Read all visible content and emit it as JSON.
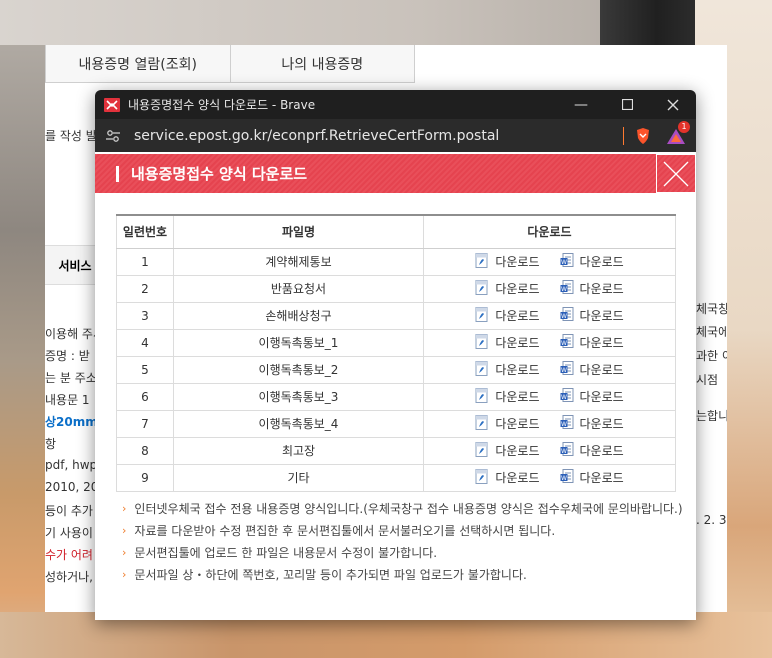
{
  "bg_page": {
    "tabs": [
      "내용증명 열람(조회)",
      "나의 내용증명"
    ],
    "left_lines": [
      "를 작성 발",
      "서비스",
      "이용해 주서",
      "증명 : 받",
      "는 분 주소",
      "내용문 1",
      "상20mm",
      "항",
      " pdf, hwp",
      "2010, 201",
      " 등이 추가",
      "기 사용이",
      "수가 어려",
      "성하거나,"
    ],
    "right_lines": [
      "체국창",
      "체국에",
      "과한 이",
      " 시점",
      "는합니",
      ". 2. 3."
    ]
  },
  "window": {
    "title": "내용증명접수 양식 다운로드 - Brave",
    "url": "service.epost.go.kr/econprf.RetrieveCertForm.postal",
    "badge_count": "1"
  },
  "popup": {
    "heading": "내용증명접수 양식 다운로드",
    "columns": [
      "일련번호",
      "파일명",
      "다운로드"
    ],
    "download_label": "다운로드",
    "rows": [
      {
        "no": "1",
        "name": "계약해제통보"
      },
      {
        "no": "2",
        "name": "반품요청서"
      },
      {
        "no": "3",
        "name": "손해배상청구"
      },
      {
        "no": "4",
        "name": "이행독촉통보_1"
      },
      {
        "no": "5",
        "name": "이행독촉통보_2"
      },
      {
        "no": "6",
        "name": "이행독촉통보_3"
      },
      {
        "no": "7",
        "name": "이행독촉통보_4"
      },
      {
        "no": "8",
        "name": "최고장"
      },
      {
        "no": "9",
        "name": "기타"
      }
    ],
    "notes": [
      "인터넷우체국 접수 전용 내용증명 양식입니다.(우체국창구 접수 내용증명 양식은 접수우체국에 문의바랍니다.)",
      "자료를 다운받아 수정 편집한 후 문서편집툴에서 문서불러오기를 선택하시면 됩니다.",
      "문서편집툴에 업로드 한 파일은 내용문서 수정이 불가합니다.",
      "문서파일 상・하단에 쪽번호, 꼬리말 등이 추가되면 파일 업로드가 불가합니다."
    ]
  },
  "colors": {
    "header_red": "#e5434f",
    "note_arrow": "#ef7d2d",
    "titlebar": "#1f1f1f"
  }
}
